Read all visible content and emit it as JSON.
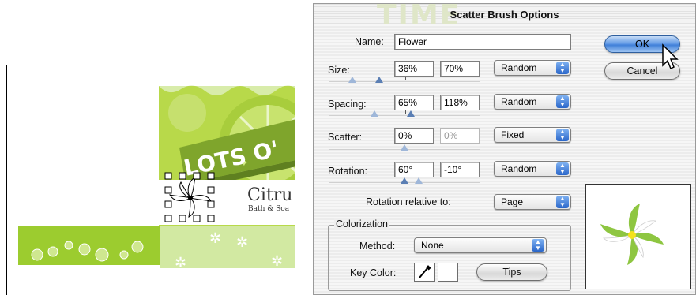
{
  "artwork": {
    "banner_text": "LOTS O'",
    "logo_line1": "Citru",
    "logo_line2": "Bath & Soa"
  },
  "dialog": {
    "title": "Scatter Brush Options",
    "watermark": "TIME",
    "name": {
      "label": "Name:",
      "value": "Flower"
    },
    "size": {
      "label": "Size:",
      "min": "36%",
      "max": "70%",
      "mode": "Random"
    },
    "spacing": {
      "label": "Spacing:",
      "min": "65%",
      "max": "118%",
      "mode": "Random"
    },
    "scatter": {
      "label": "Scatter:",
      "min": "0%",
      "max": "0%",
      "mode": "Fixed"
    },
    "rotation": {
      "label": "Rotation:",
      "min": "60°",
      "max": "-10°",
      "mode": "Random"
    },
    "rotation_relative": {
      "label": "Rotation relative to:",
      "value": "Page"
    },
    "colorization": {
      "title": "Colorization",
      "method_label": "Method:",
      "method_value": "None",
      "key_color_label": "Key Color:",
      "tips_label": "Tips"
    },
    "ok_label": "OK",
    "cancel_label": "Cancel"
  },
  "icons": {
    "popup_arrow": "up-down-arrows-icon",
    "eyedropper": "eyedropper-icon",
    "cursor": "arrow-cursor-icon"
  },
  "colors": {
    "lime": "#b8d94a",
    "light_lime": "#d3ea8d",
    "ok_blue": "#4a88dd",
    "flower_center": "#f4e21a",
    "flower_petal": "#8ec641"
  }
}
